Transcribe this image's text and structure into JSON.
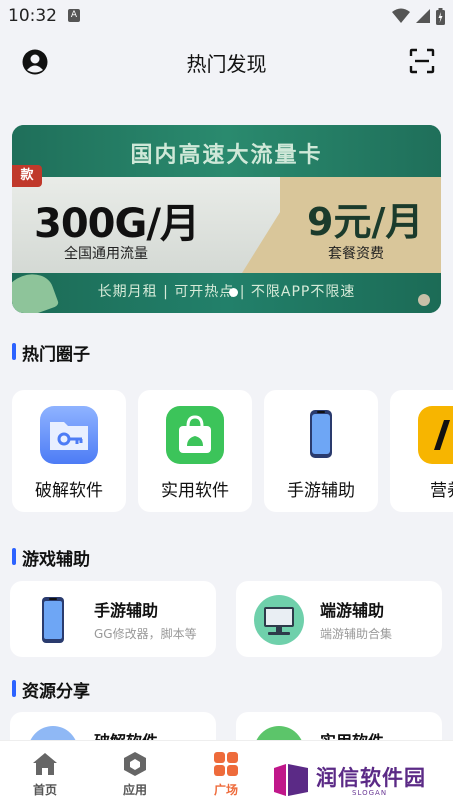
{
  "status_bar": {
    "time": "10:32",
    "notif_letter": "A"
  },
  "header": {
    "title": "热门发现"
  },
  "banner": {
    "headline": "国内高速大流量卡",
    "tag": "款",
    "data_amount": "300G/月",
    "data_desc": "全国通用流量",
    "fee": "9元/月",
    "fee_desc": "套餐资费",
    "footer": "长期月租 | 可开热点 | 不限APP不限速"
  },
  "hot_circles": {
    "title": "热门圈子",
    "items": [
      {
        "label": "破解软件",
        "icon": "folder-key-icon"
      },
      {
        "label": "实用软件",
        "icon": "shopping-bag-icon"
      },
      {
        "label": "手游辅助",
        "icon": "phone-icon"
      },
      {
        "label": "营养",
        "icon": "yellow-app-icon"
      }
    ]
  },
  "game_assist": {
    "title": "游戏辅助",
    "items": [
      {
        "title": "手游辅助",
        "desc": "GG修改器，脚本等",
        "icon": "phone-icon"
      },
      {
        "title": "端游辅助",
        "desc": "端游辅助合集",
        "icon": "monitor-icon"
      }
    ]
  },
  "resource_share": {
    "title": "资源分享",
    "items": [
      {
        "title": "破解软件",
        "icon": "folder-icon"
      },
      {
        "title": "实用软件",
        "icon": "bag-icon"
      }
    ]
  },
  "tabbar": {
    "tabs": [
      {
        "label": "首页",
        "icon": "home-icon"
      },
      {
        "label": "应用",
        "icon": "cube-icon"
      },
      {
        "label": "广场",
        "icon": "grid-icon",
        "active": true
      }
    ]
  },
  "watermark": {
    "text": "润信软件园",
    "slogan": "SLOGAN"
  },
  "colors": {
    "accent": "#2c62ff",
    "active_tab": "#ee6b3b",
    "banner_green": "#1f6f5a"
  }
}
